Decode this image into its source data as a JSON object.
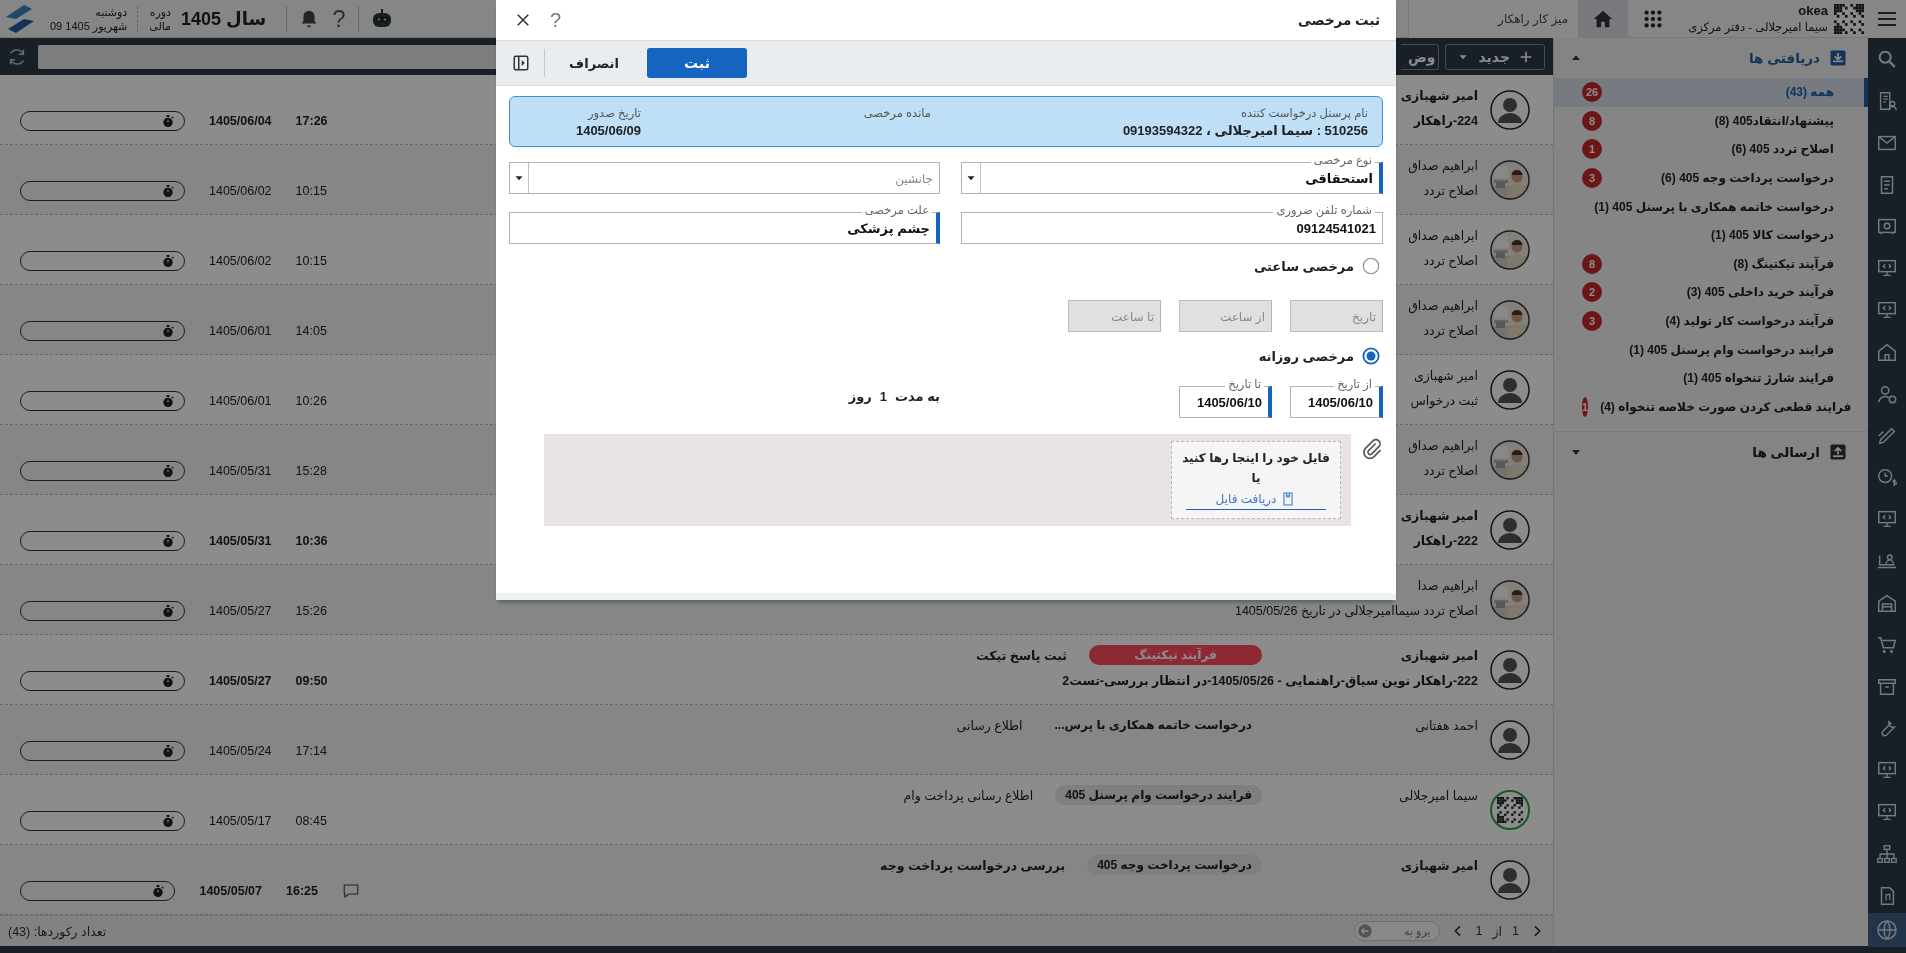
{
  "top_bar": {
    "weekday": "دوشنبه",
    "date": "09 شهریور 1405",
    "period_line_1": "دوره",
    "period_line_2": "مالی",
    "year": "سال 1405",
    "help": "?",
    "workspace_tab": "میز کار راهکار",
    "company": "okea",
    "user": "سیما امیرجلالی - دفتر مرکزی"
  },
  "toolbar": {
    "new_button": "جدید",
    "second_button": "وض"
  },
  "messages": [
    {
      "kind": "silhouette",
      "name": "امیر شهبازی",
      "subject": "224-راهکار",
      "date": "1405/06/04",
      "time": "17:26",
      "unread": true
    },
    {
      "name": "ابراهیم صداق",
      "subject": "اصلاح تردد",
      "date": "1405/06/02",
      "time": "10:15",
      "unread": false
    },
    {
      "name": "ابراهیم صداق",
      "subject": "اصلاح تردد",
      "date": "1405/06/02",
      "time": "10:15",
      "unread": false
    },
    {
      "name": "ابراهیم صداق",
      "subject": "اصلاح تردد",
      "date": "1405/06/01",
      "time": "14:05",
      "unread": false
    },
    {
      "kind": "silhouette",
      "name": "امیر شهبازی",
      "subject": "ثبت درخواس",
      "date": "1405/06/01",
      "time": "10:26",
      "unread": false
    },
    {
      "name": "ابراهیم صداق",
      "subject": "اصلاح تردد",
      "date": "1405/05/31",
      "time": "15:28",
      "unread": false
    },
    {
      "kind": "silhouette",
      "name": "امیر شهبازی",
      "subject": "222-راهکار",
      "date": "1405/05/31",
      "time": "10:36",
      "unread": true
    },
    {
      "name": "ابراهیم صدا",
      "subject": "اصلاح تردد سیماامیرجلالی در تاریخ 1405/05/26",
      "date": "1405/05/27",
      "time": "15:26",
      "unread": false
    },
    {
      "kind": "silhouette",
      "name": "امیر شهبازی",
      "tag": {
        "label": "فرآیند تیکتینگ",
        "color": "#8c2a32"
      },
      "label": "ثبت پاسخ تیکت",
      "subject": "222-راهکار نوین سیاق-راهنمایی - 1405/05/26-در انتظار بررسی-تست2",
      "date": "1405/05/27",
      "time": "09:50",
      "unread": true
    },
    {
      "kind": "silhouette",
      "name": "احمد هفتانی",
      "tag": {
        "label": "درخواست خاتمه همکاری با پرس..."
      },
      "label": "اطلاع رسانی",
      "date": "1405/05/24",
      "time": "17:14",
      "unread": false
    },
    {
      "kind": "qr",
      "name": "سیما امیرجلالی",
      "tag": {
        "label": "فرایند درخواست وام پرسنل 405",
        "color": "#7f7f7f"
      },
      "label": "اطلاع رسانی پرداخت وام",
      "date": "1405/05/17",
      "time": "08:45",
      "unread": false
    },
    {
      "kind": "silhouette",
      "name": "امیر شهبازی",
      "tag": {
        "label": "درخواست پرداخت وجه 405",
        "color": "#7f7f7f"
      },
      "label": "بررسی درخواست پرداخت وجه",
      "date": "1405/05/07",
      "time": "16:25",
      "unread": true,
      "comment": true
    }
  ],
  "footer": {
    "record_count": "تعداد رکوردها: (43)",
    "goto_placeholder": "برو به",
    "total": "1",
    "of": "از",
    "page": "1"
  },
  "sidebar": {
    "inbox": {
      "title": "دریافتی ها",
      "expanded": true,
      "items": [
        {
          "label": "همه (43)",
          "badge": "26",
          "selected": true
        },
        {
          "label": "پیشنهاد/انتقاد405 (8)",
          "badge": "8",
          "selected": false
        },
        {
          "label": "اصلاح تردد 405 (6)",
          "badge": "1",
          "selected": false
        },
        {
          "label": "درخواست پرداخت وجه 405 (6)",
          "badge": "3",
          "selected": false
        },
        {
          "label": "درخواست خاتمه همکاری با پرسنل 405 (1)",
          "selected": false
        },
        {
          "label": "درخواست کالا 405 (1)",
          "selected": false
        },
        {
          "label": "فرآیند تیکتینگ (8)",
          "badge": "8",
          "selected": false
        },
        {
          "label": "فرآیند خرید داخلی 405 (3)",
          "badge": "2",
          "selected": false
        },
        {
          "label": "فرآیند درخواست کار تولید (4)",
          "badge": "3",
          "selected": false
        },
        {
          "label": "فرایند درخواست وام پرسنل 405 (1)",
          "selected": false
        },
        {
          "label": "فرایند شارژ تنخواه 405 (1)",
          "selected": false
        },
        {
          "label": "فرایند قطعی کردن صورت خلاصه تنخواه (4)",
          "badge": "1",
          "selected": false
        }
      ]
    },
    "outbox": {
      "title": "ارسالی ها",
      "expanded": false
    }
  },
  "dialog": {
    "title": "ثبت مرخصی",
    "help": "?",
    "submit": "ثبت",
    "cancel": "انصراف",
    "info": [
      {
        "label": "نام پرسنل درخواست کننده",
        "value": "510256 : سیما امیرجلالی ، 09193594322"
      },
      {
        "label": "مانده مرخصی"
      },
      {
        "label": "تاریخ صدور",
        "value": "1405/06/09"
      }
    ],
    "fields": [
      {
        "kind": "select",
        "label": "نوع مرخصی",
        "value": "استحقاقی",
        "required": true
      },
      {
        "kind": "select",
        "placeholder": "جانشین",
        "required": false
      },
      {
        "kind": "text",
        "label": "شماره تلفن ضروری",
        "value": "09124541021",
        "required": false
      },
      {
        "kind": "text",
        "label": "علت مرخصی",
        "value": "چشم پزشکی",
        "required": true
      }
    ],
    "hourly": {
      "label": "مرخصی ساعتی",
      "selected": false,
      "fields": [
        {
          "placeholder": "تاریخ",
          "disabled": true
        },
        {
          "placeholder": "از ساعت",
          "disabled": true
        },
        {
          "placeholder": "تا ساعت",
          "disabled": true
        }
      ]
    },
    "daily": {
      "label": "مرخصی روزانه",
      "selected": true,
      "fields": [
        {
          "label": "از تاریخ",
          "value": "1405/06/10",
          "required": true
        },
        {
          "label": "تا تاریخ",
          "value": "1405/06/10",
          "required": true
        }
      ],
      "duration_prefix": "به مدت",
      "duration_value": "1",
      "duration_unit": "روز"
    },
    "attachments": {
      "drop_hint": "فایل خود را اینجا رها کنید",
      "or": "یا",
      "browse": "دریافت فایل"
    }
  }
}
